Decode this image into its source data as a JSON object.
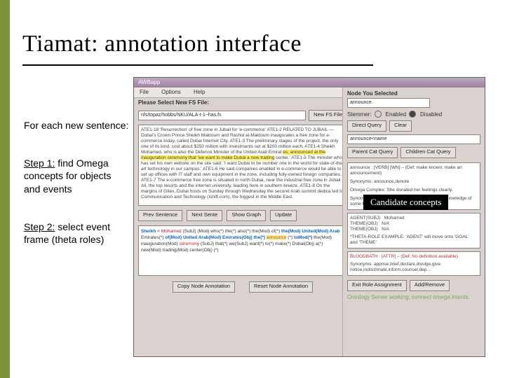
{
  "title": "Tiamat: annotation interface",
  "sidebar": {
    "intro": "For each new sentence:",
    "step1_lead": "Step 1:",
    "step1_rest": " find Omega concepts for objects and events",
    "step2_lead": "Step 2:",
    "step2_rest": " select event frame (theta roles)"
  },
  "callout": {
    "candidates": "Candidate concepts"
  },
  "app": {
    "window_title": "AWBapp",
    "menubar": [
      "File",
      "Options",
      "Help"
    ],
    "file_row": {
      "label": "Please Select New FS File:",
      "path": "nfs/topaz/hobbs/NKU/ALA-t-1~has.fs",
      "button": "New FS File"
    },
    "right_header": {
      "label": "Node You Selected"
    },
    "selected_node": "announce",
    "stemmer": {
      "label": "Stemmer:",
      "opt_enabled": "Enabled",
      "opt_disabled": "Disabled"
    },
    "query_btns": {
      "direct": "Direct Query",
      "clear": "Clear"
    },
    "query_field": "announce<name",
    "parent_btn": "Parent Cat Query",
    "children_btn": "Children Cat Query",
    "corpus_lines": [
      "ATE1-18 'Resurrection' of free zone in Jubail for 'e-commerce'   ATE1-2 RELATED TO JUBAIL",
      "— Dubai's Crown Prince Sheikh Maktoum and Rashid al-Maktoum inaugurates a free zone",
      "for e-commerce today, called Dubai Internet City.   ATE1-3 The preliminary stages of the",
      "project, the only one of its kind, cost about $250 million with investments set at $200 million",
      "each.   ATE1-4 Sheikh Mohamed, who is also the Defence Minister of the United Arab Emirat",
      "es, announced at the inauguration ceremony that 'we want to make Dubai a new trading",
      "center.'   ATE1-5 The minister who has set his own website on the site said: 'I want Dubai to be",
      "number one in the world for state-of-the-art technology in our campus.'   ATE1-6 He said",
      "companies enabled in e-commerce would be able to set up offices with IT staff and own",
      "equipment in the zone, including fully-owned foreign companies.   ATE1-7 The",
      "e-commerce free zone is situated in north Dubai, near the industrial free zone in Jubail Ali,",
      "the top resorts and the internet university, leading here in southern breeze.   ATE1-8 On the",
      "margins of Gitex, Dubai hosts on Sunday through Wednesday the second Arab summit dedica",
      "ted to Communication and Technology (Ishift.com), the biggest in the Middle East."
    ],
    "mid_buttons": [
      "Prev Sentence",
      "Next Sente",
      "Show Graph",
      "Update"
    ],
    "sentence_tokens": [
      {
        "t": "Sheikh",
        "c": "mod"
      },
      {
        "t": "<",
        "c": ""
      },
      {
        "t": "Mohamed",
        "c": "subj"
      },
      {
        "t": "(SubJ) (Mod) who(*) the(*) also(*) the(Mod) of(*)",
        "c": ""
      },
      {
        "t": "the(Mod) United(Mod) Arab",
        "c": "mod"
      },
      {
        "t": "Emirates(*)",
        "c": ""
      },
      {
        "t": "of(Mod) United Arab(Mod) Emirates(Obj) the(*)",
        "c": "mod"
      },
      {
        "t": "announce",
        "c": "verb"
      },
      {
        "t": "(*)",
        "c": ""
      },
      {
        "t": "toMod(*)",
        "c": "mod"
      },
      {
        "t": "the(Mod) inauguration(Mod)",
        "c": ""
      },
      {
        "t": "ceremony",
        "c": "subj"
      },
      {
        "t": "(SubJ) that(*) we(SubJ) want(*) to(*) make(*)",
        "c": ""
      },
      {
        "t": "Dubai(Obj) a(*) new(Mod) trading(Mod) center(Obj) (*)",
        "c": ""
      }
    ],
    "footer_buttons": [
      "Copy Node Annotation",
      "Reset Node Annotation"
    ],
    "candidates": {
      "head": "announce : [VERB] [WN] – (Def: make known; make an announcement)",
      "syn": "Synonyms: announce,denote",
      "ex": "Omega Complex: She donated her feelings clearly.",
      "def2": "Synonym: announce,report,narrate(def: impart knowledge of some fact, state or aff…"
    },
    "frame": {
      "rows": [
        [
          "AGENT(SUBJ)",
          "Mohamed"
        ],
        [
          "THEME(OBJ)",
          "N/A"
        ],
        [
          "THEME(OBJ)",
          "N/A"
        ]
      ],
      "note": "*THETA-ROLE EXAMPLE: 'AGENT' will move onto 'GOAL' and 'THEME'"
    },
    "bloodbath": {
      "head": "BLOODBATH : [ATTR] – (Def: No definition available)",
      "body": "Synonyms: apprise,brief,declare,divulge,give notice,indoctrinate,inform,counsel,dep…"
    },
    "right_footer": [
      "Exit Role Assignment",
      "Add/Remove"
    ],
    "ontology_status": "Ontology Server working: connect omega intents."
  }
}
